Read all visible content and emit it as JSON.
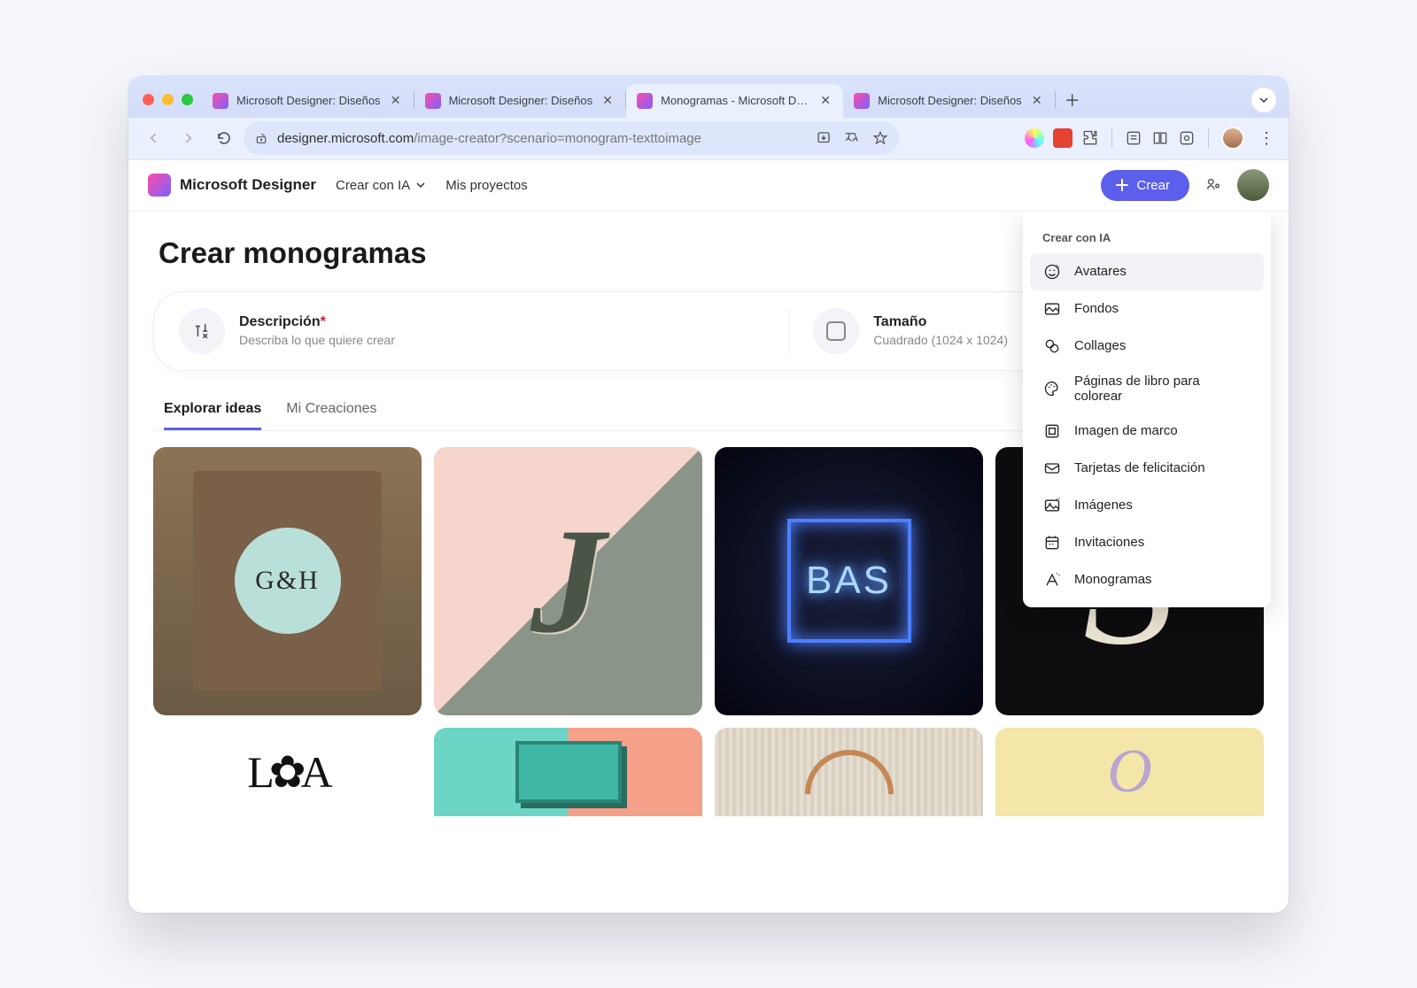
{
  "browser": {
    "tabs": [
      {
        "title": "Microsoft Designer: Diseños"
      },
      {
        "title": "Microsoft Designer: Diseños"
      },
      {
        "title": "Monogramas - Microsoft Designer"
      },
      {
        "title": "Microsoft Designer: Diseños"
      }
    ],
    "active_tab_index": 2,
    "url_host": "designer.microsoft.com",
    "url_path": "/image-creator?scenario=monogram-texttoimage"
  },
  "app": {
    "brand": "Microsoft Designer",
    "nav_create": "Crear con IA",
    "nav_projects": "Mis proyectos",
    "create_button": "Crear"
  },
  "page": {
    "title": "Crear monogramas",
    "desc_label": "Descripción",
    "desc_required": "*",
    "desc_placeholder": "Describa lo que quiere crear",
    "size_label": "Tamaño",
    "size_value": "Cuadrado (1024 x 1024)",
    "tabs": {
      "explore": "Explorar ideas",
      "mine": "Mi Creaciones"
    }
  },
  "ideas": {
    "gh": "G&H",
    "bas": "BAS"
  },
  "dropdown": {
    "header": "Crear con IA",
    "items": [
      {
        "label": "Avatares",
        "hover": true
      },
      {
        "label": "Fondos"
      },
      {
        "label": "Collages"
      },
      {
        "label": "Páginas de libro para colorear"
      },
      {
        "label": "Imagen de marco"
      },
      {
        "label": "Tarjetas de felicitación"
      },
      {
        "label": "Imágenes"
      },
      {
        "label": "Invitaciones"
      },
      {
        "label": "Monogramas"
      }
    ]
  }
}
